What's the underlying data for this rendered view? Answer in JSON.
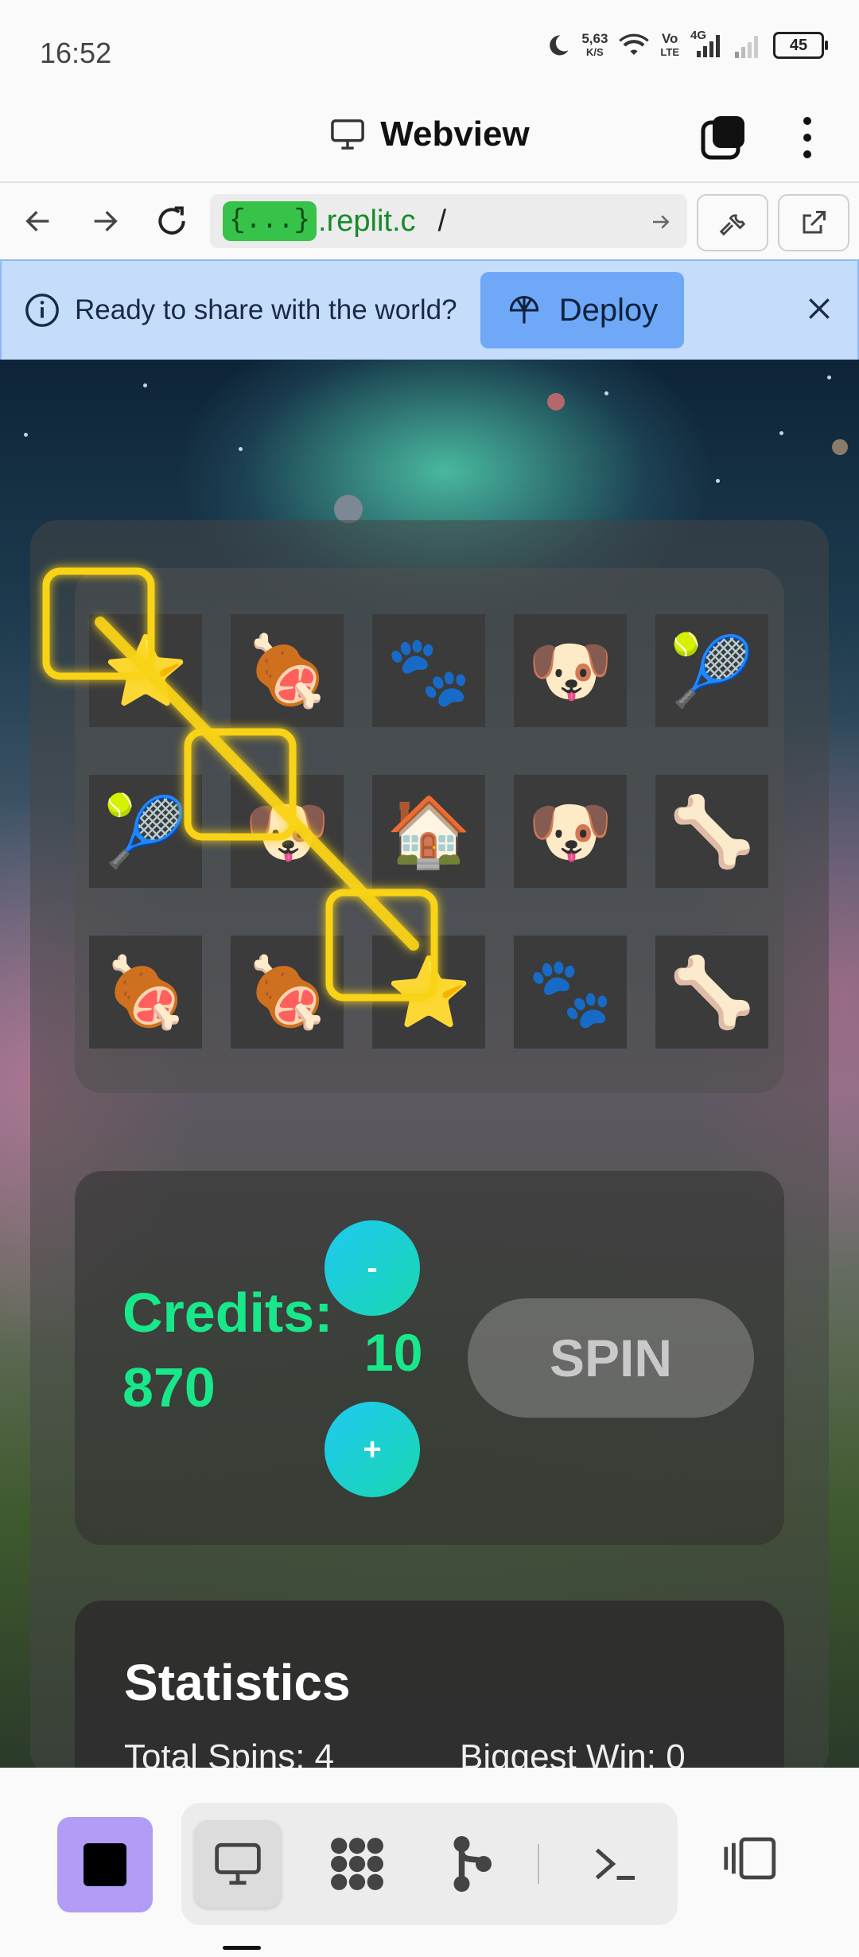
{
  "status_bar": {
    "time": "16:52",
    "net_speed_value": "5,63",
    "net_speed_unit": "K/S",
    "volte_top": "Vo",
    "volte_bottom": "LTE",
    "network": "4G",
    "battery": "45"
  },
  "title_bar": {
    "title": "Webview",
    "icons": [
      "monitor-icon",
      "tabs-icon",
      "more-vert-icon"
    ]
  },
  "url_bar": {
    "chip": "{...}",
    "domain": ".replit.c",
    "path": "/"
  },
  "banner": {
    "text": "Ready to share with the world?",
    "button_label": "Deploy"
  },
  "game": {
    "reels": [
      [
        "⭐",
        "🍖",
        "🐾",
        "🐶",
        "🎾"
      ],
      [
        "🎾",
        "🐶",
        "🏠",
        "🐶",
        "🦴"
      ],
      [
        "🍖",
        "🍖",
        "⭐",
        "🐾",
        "🦴"
      ]
    ],
    "highlight_color": "#f9d316",
    "credits_label": "Credits:",
    "credits_value": "870",
    "bet_minus": "-",
    "bet_value": "10",
    "bet_plus": "+",
    "spin_label": "SPIN",
    "stats_title": "Statistics",
    "stats_total_spins": "Total Spins: 4",
    "stats_biggest_win": "Biggest Win: 0"
  },
  "bottom_bar": {
    "icons": [
      "stop-icon",
      "webview-icon",
      "extensions-icon",
      "git-icon",
      "shell-icon",
      "layout-icon"
    ],
    "accent": "#b29cf5"
  }
}
